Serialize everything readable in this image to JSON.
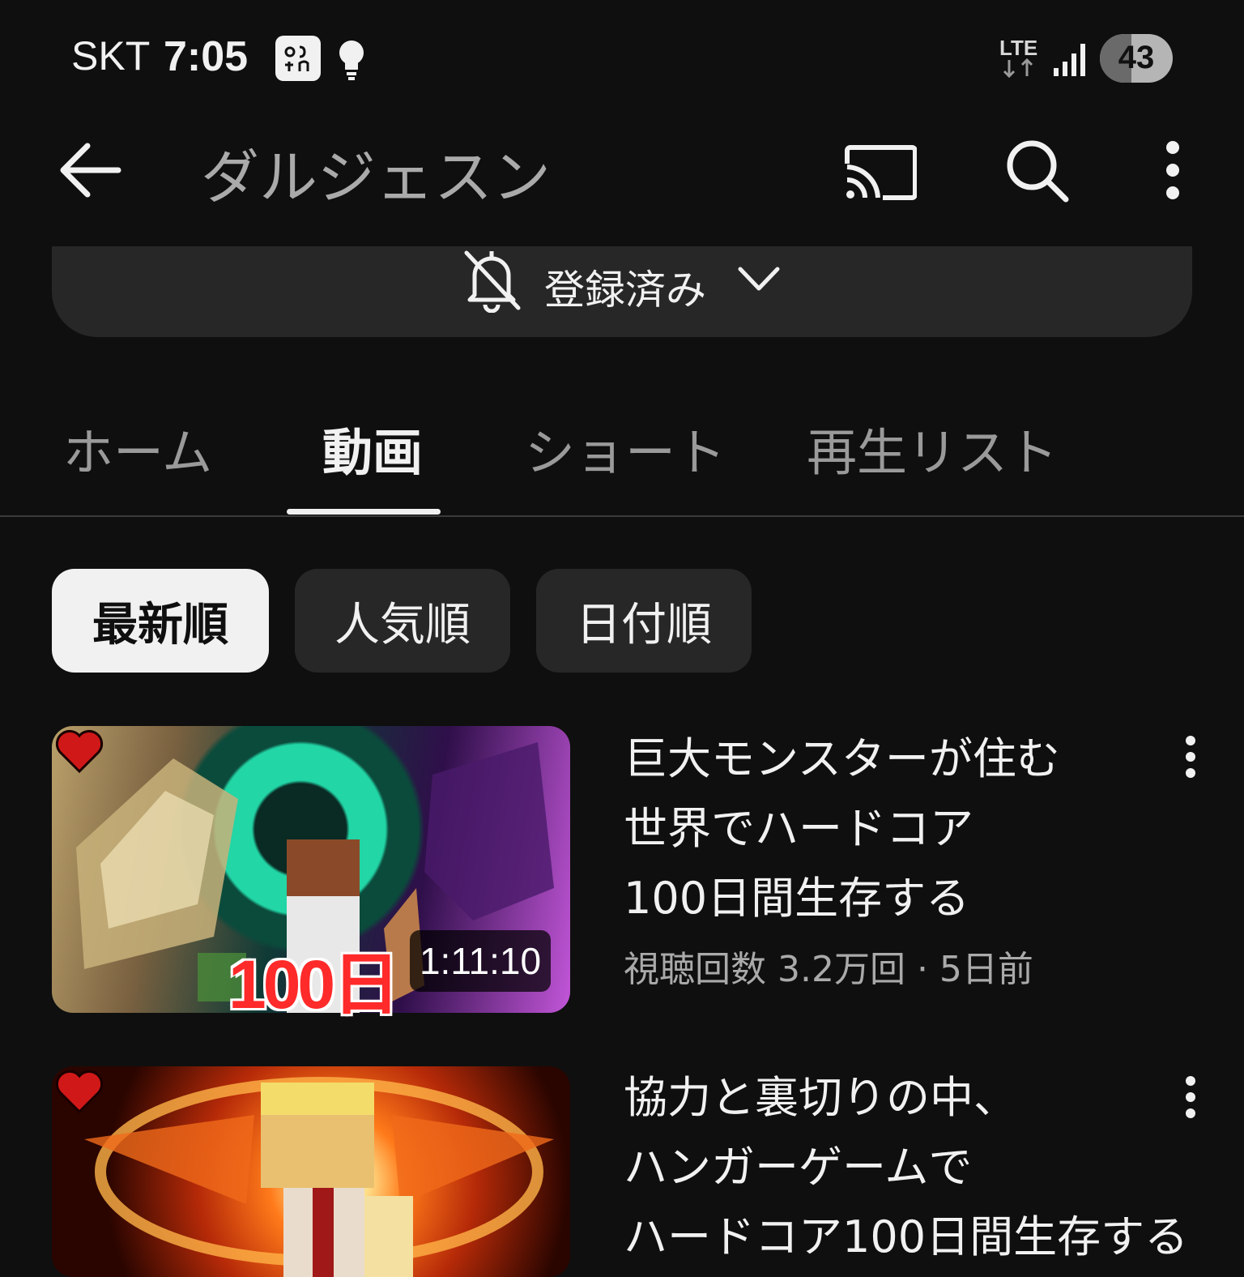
{
  "status_bar": {
    "carrier": "SKT",
    "time": "7:05",
    "network": "LTE",
    "battery_level": "43",
    "icons": [
      "app-notification-icon",
      "lightbulb-icon",
      "lte-icon",
      "signal-icon",
      "battery-icon"
    ]
  },
  "header": {
    "title": "ダルジェスン",
    "icons": [
      "back-arrow-icon",
      "cast-icon",
      "search-icon",
      "more-vert-icon"
    ]
  },
  "subscribe": {
    "label": "登録済み",
    "icons": [
      "bell-off-icon",
      "chevron-down-icon"
    ]
  },
  "tabs": [
    {
      "label": "ホーム",
      "active": false
    },
    {
      "label": "動画",
      "active": true
    },
    {
      "label": "ショート",
      "active": false
    },
    {
      "label": "再生リスト",
      "active": false
    }
  ],
  "chips": [
    {
      "label": "最新順",
      "selected": true
    },
    {
      "label": "人気順",
      "selected": false
    },
    {
      "label": "日付順",
      "selected": false
    }
  ],
  "videos": [
    {
      "title_lines": [
        "巨大モンスターが住む",
        "世界でハードコア",
        "100日間生存する"
      ],
      "meta": "視聴回数 3.2万回 · 5日前",
      "duration": "1:11:10",
      "thumbnail_text": "100日"
    },
    {
      "title_lines": [
        "協力と裏切りの中、",
        "ハンガーゲームで",
        "ハードコア100日間生存する"
      ]
    }
  ],
  "colors": {
    "background": "#0f0f0f",
    "chip": "#272727",
    "chip_selected": "#f1f1f1",
    "text_primary": "#f1f1f1",
    "text_secondary": "#aaaaaa"
  }
}
